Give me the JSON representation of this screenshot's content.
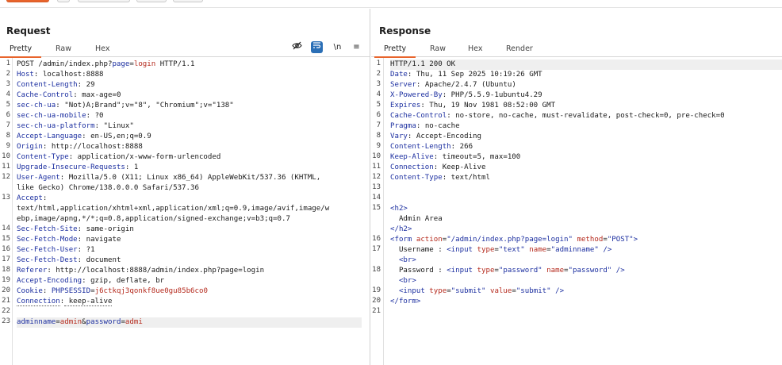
{
  "request": {
    "title": "Request",
    "tabs": [
      "Pretty",
      "Raw",
      "Hex"
    ],
    "active_tab": "Pretty",
    "tools": {
      "newline_toggle": "\\n",
      "menu": "≡"
    },
    "lines": [
      {
        "n": "1",
        "method": "POST",
        "path": "/admin/index.php?",
        "param": "page",
        "eq": "=",
        "val": "login",
        "rest": " HTTP/1.1"
      },
      {
        "n": "2",
        "name": "Host",
        "value": " localhost:8888"
      },
      {
        "n": "3",
        "name": "Content-Length",
        "value": " 29"
      },
      {
        "n": "4",
        "name": "Cache-Control",
        "value": " max-age=0"
      },
      {
        "n": "5",
        "name": "sec-ch-ua",
        "value": " \"Not)A;Brand\";v=\"8\", \"Chromium\";v=\"138\""
      },
      {
        "n": "6",
        "name": "sec-ch-ua-mobile",
        "value": " ?0"
      },
      {
        "n": "7",
        "name": "sec-ch-ua-platform",
        "value": " \"Linux\""
      },
      {
        "n": "8",
        "name": "Accept-Language",
        "value": " en-US,en;q=0.9"
      },
      {
        "n": "9",
        "name": "Origin",
        "value": " http://localhost:8888"
      },
      {
        "n": "10",
        "name": "Content-Type",
        "value": " application/x-www-form-urlencoded"
      },
      {
        "n": "11",
        "name": "Upgrade-Insecure-Requests",
        "value": " 1"
      },
      {
        "n": "12",
        "name": "User-Agent",
        "value": " Mozilla/5.0 (X11; Linux x86_64) AppleWebKit/537.36 (KHTML,"
      },
      {
        "n": "",
        "cont": "like Gecko) Chrome/138.0.0.0 Safari/537.36"
      },
      {
        "n": "13",
        "name": "Accept",
        "value": ""
      },
      {
        "n": "",
        "cont": "text/html,application/xhtml+xml,application/xml;q=0.9,image/avif,image/w"
      },
      {
        "n": "",
        "cont": "ebp,image/apng,*/*;q=0.8,application/signed-exchange;v=b3;q=0.7"
      },
      {
        "n": "14",
        "name": "Sec-Fetch-Site",
        "value": " same-origin"
      },
      {
        "n": "15",
        "name": "Sec-Fetch-Mode",
        "value": " navigate"
      },
      {
        "n": "16",
        "name": "Sec-Fetch-User",
        "value": " ?1"
      },
      {
        "n": "17",
        "name": "Sec-Fetch-Dest",
        "value": " document"
      },
      {
        "n": "18",
        "name": "Referer",
        "value": " http://localhost:8888/admin/index.php?page=login"
      },
      {
        "n": "19",
        "name": "Accept-Encoding",
        "value": " gzip, deflate, br"
      },
      {
        "n": "20",
        "name": "Cookie",
        "value": " ",
        "cookie_name": "PHPSESSID",
        "cookie_eq": "=",
        "cookie_val": "j6ctkqj3qonkf8ue0gu85b6co0"
      },
      {
        "n": "21",
        "name": "Connection",
        "value": " keep-alive",
        "dotted": true
      },
      {
        "n": "22",
        "cont": ""
      },
      {
        "n": "23",
        "body": [
          {
            "k": "adminname",
            "eq": "=",
            "v": "admin",
            "amp": "&"
          },
          {
            "k": "password",
            "eq": "=",
            "v": "admi",
            "amp": ""
          }
        ]
      }
    ]
  },
  "response": {
    "title": "Response",
    "tabs": [
      "Pretty",
      "Raw",
      "Hex",
      "Render"
    ],
    "active_tab": "Pretty",
    "lines": [
      {
        "n": "1",
        "cont": "HTTP/1.1 200 OK"
      },
      {
        "n": "2",
        "name": "Date",
        "value": " Thu, 11 Sep 2025 10:19:26 GMT"
      },
      {
        "n": "3",
        "name": "Server",
        "value": " Apache/2.4.7 (Ubuntu)"
      },
      {
        "n": "4",
        "name": "X-Powered-By",
        "value": " PHP/5.5.9-1ubuntu4.29"
      },
      {
        "n": "5",
        "name": "Expires",
        "value": " Thu, 19 Nov 1981 08:52:00 GMT"
      },
      {
        "n": "6",
        "name": "Cache-Control",
        "value": " no-store, no-cache, must-revalidate, post-check=0, pre-check=0"
      },
      {
        "n": "7",
        "name": "Pragma",
        "value": " no-cache"
      },
      {
        "n": "8",
        "name": "Vary",
        "value": " Accept-Encoding"
      },
      {
        "n": "9",
        "name": "Content-Length",
        "value": " 266"
      },
      {
        "n": "10",
        "name": "Keep-Alive",
        "value": " timeout=5, max=100"
      },
      {
        "n": "11",
        "name": "Connection",
        "value": " Keep-Alive"
      },
      {
        "n": "12",
        "name": "Content-Type",
        "value": " text/html"
      },
      {
        "n": "13",
        "cont": ""
      },
      {
        "n": "14",
        "cont": ""
      },
      {
        "n": "15",
        "html": [
          {
            "t": "tag",
            "s": "<h2>"
          }
        ]
      },
      {
        "n": "",
        "html": [
          {
            "t": "plain",
            "s": "  Admin Area"
          }
        ]
      },
      {
        "n": "",
        "html": [
          {
            "t": "tag",
            "s": "</h2>"
          }
        ]
      },
      {
        "n": "16",
        "html": [
          {
            "t": "tag",
            "s": "<form "
          },
          {
            "t": "an",
            "s": "action"
          },
          {
            "t": "plain",
            "s": "="
          },
          {
            "t": "av",
            "s": "\"/admin/index.php?page=login\""
          },
          {
            "t": "plain",
            "s": " "
          },
          {
            "t": "an",
            "s": "method"
          },
          {
            "t": "plain",
            "s": "="
          },
          {
            "t": "av",
            "s": "\"POST\""
          },
          {
            "t": "tag",
            "s": ">"
          }
        ]
      },
      {
        "n": "17",
        "html": [
          {
            "t": "plain",
            "s": "  Username : "
          },
          {
            "t": "tag",
            "s": "<input "
          },
          {
            "t": "an",
            "s": "type"
          },
          {
            "t": "plain",
            "s": "="
          },
          {
            "t": "av",
            "s": "\"text\""
          },
          {
            "t": "plain",
            "s": " "
          },
          {
            "t": "an",
            "s": "name"
          },
          {
            "t": "plain",
            "s": "="
          },
          {
            "t": "av",
            "s": "\"adminname\""
          },
          {
            "t": "tag",
            "s": " />"
          }
        ]
      },
      {
        "n": "",
        "html": [
          {
            "t": "plain",
            "s": "  "
          },
          {
            "t": "tag",
            "s": "<br>"
          }
        ]
      },
      {
        "n": "18",
        "html": [
          {
            "t": "plain",
            "s": "  Password : "
          },
          {
            "t": "tag",
            "s": "<input "
          },
          {
            "t": "an",
            "s": "type"
          },
          {
            "t": "plain",
            "s": "="
          },
          {
            "t": "av",
            "s": "\"password\""
          },
          {
            "t": "plain",
            "s": " "
          },
          {
            "t": "an",
            "s": "name"
          },
          {
            "t": "plain",
            "s": "="
          },
          {
            "t": "av",
            "s": "\"password\""
          },
          {
            "t": "tag",
            "s": " />"
          }
        ]
      },
      {
        "n": "",
        "html": [
          {
            "t": "plain",
            "s": "  "
          },
          {
            "t": "tag",
            "s": "<br>"
          }
        ]
      },
      {
        "n": "19",
        "html": [
          {
            "t": "plain",
            "s": "  "
          },
          {
            "t": "tag",
            "s": "<input "
          },
          {
            "t": "an",
            "s": "type"
          },
          {
            "t": "plain",
            "s": "="
          },
          {
            "t": "av",
            "s": "\"submit\""
          },
          {
            "t": "plain",
            "s": " "
          },
          {
            "t": "an",
            "s": "value"
          },
          {
            "t": "plain",
            "s": "="
          },
          {
            "t": "av",
            "s": "\"submit\""
          },
          {
            "t": "tag",
            "s": " />"
          }
        ]
      },
      {
        "n": "20",
        "html": [
          {
            "t": "tag",
            "s": "</form>"
          }
        ]
      },
      {
        "n": "21",
        "cont": ""
      }
    ]
  },
  "colors": {
    "accent": "#e8642c",
    "header_name": "#1c2fa0",
    "param_value": "#b52a1d",
    "toolbar_blue": "#2b6fb6"
  },
  "icons": [
    "eye-slash-icon",
    "wrap-lines-icon",
    "newline-icon",
    "menu-icon"
  ]
}
